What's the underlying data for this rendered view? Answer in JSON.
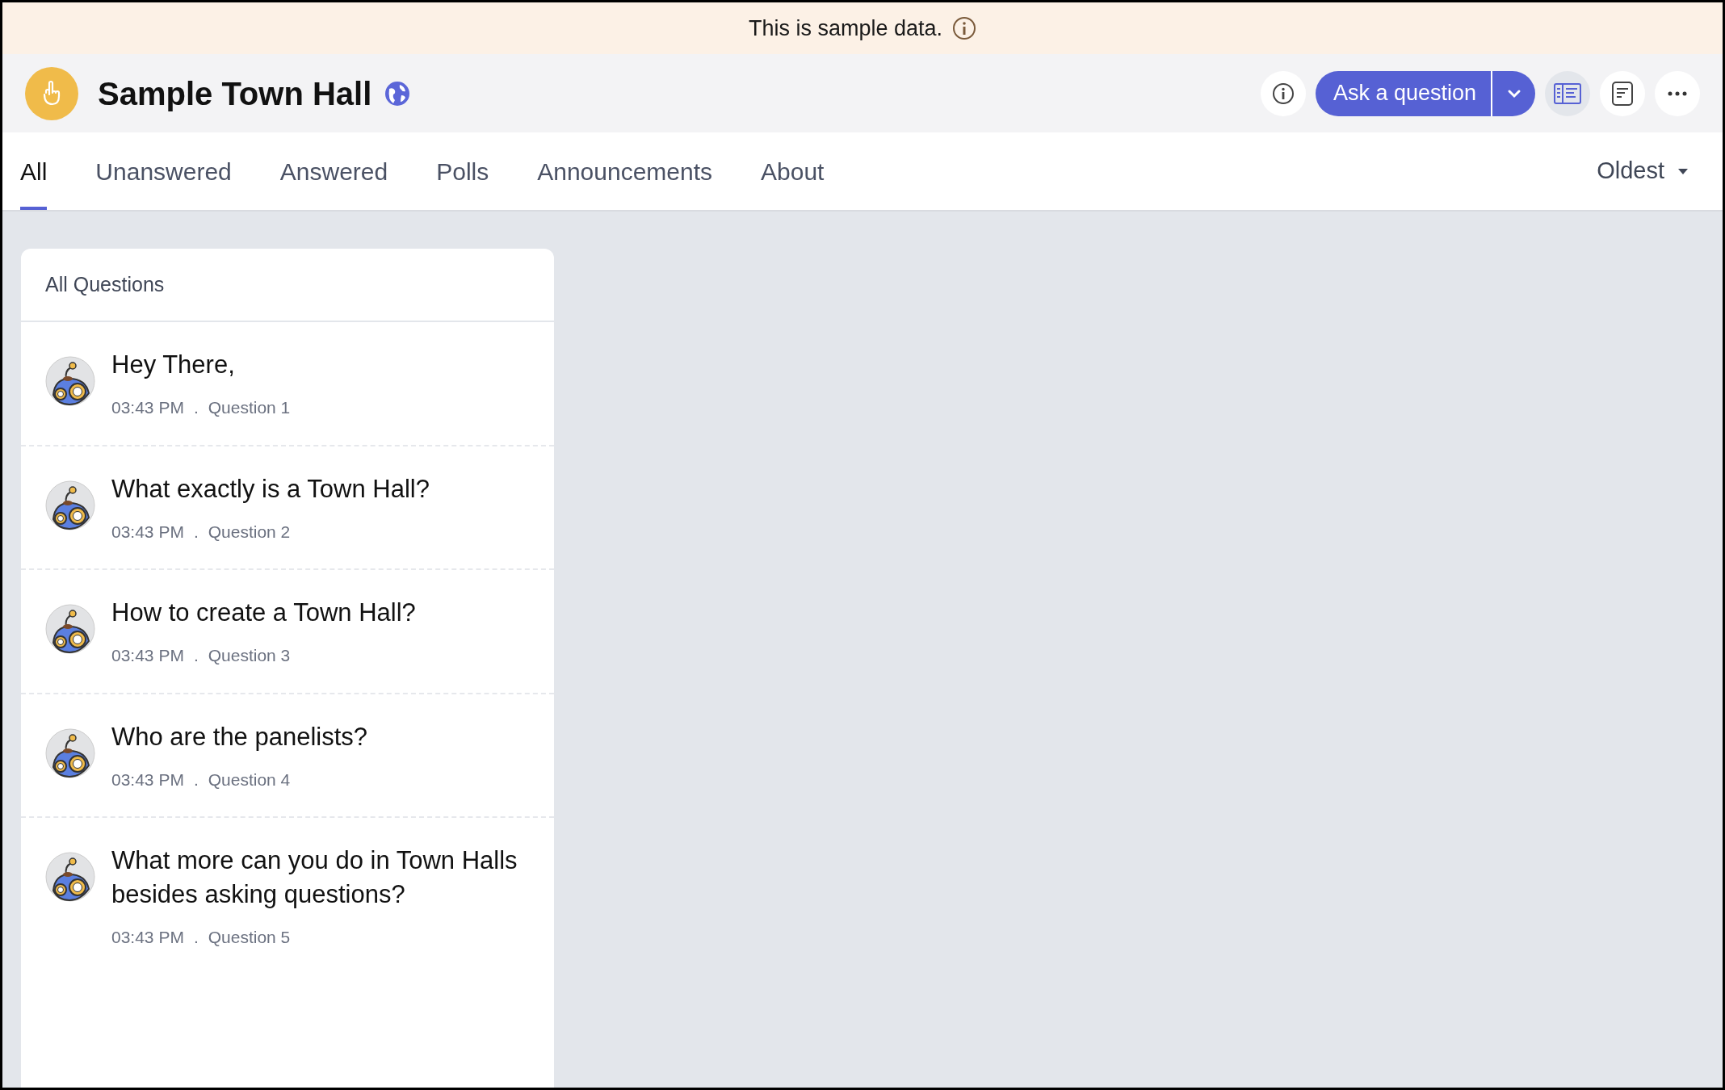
{
  "banner": {
    "text": "This is sample data."
  },
  "header": {
    "title": "Sample Town Hall",
    "ask_button": "Ask a question"
  },
  "tabs": [
    {
      "label": "All",
      "selected": true
    },
    {
      "label": "Unanswered",
      "selected": false
    },
    {
      "label": "Answered",
      "selected": false
    },
    {
      "label": "Polls",
      "selected": false
    },
    {
      "label": "Announcements",
      "selected": false
    },
    {
      "label": "About",
      "selected": false
    }
  ],
  "sort": {
    "label": "Oldest"
  },
  "questions_panel": {
    "title": "All Questions",
    "questions": [
      {
        "text": "Hey There,",
        "time": "03:43 PM",
        "separator": ".",
        "number": "Question 1"
      },
      {
        "text": "What exactly is a Town Hall?",
        "time": "03:43 PM",
        "separator": ".",
        "number": "Question 2"
      },
      {
        "text": "How to create a Town Hall?",
        "time": "03:43 PM",
        "separator": ".",
        "number": "Question 3"
      },
      {
        "text": "Who are the panelists?",
        "time": "03:43 PM",
        "separator": ".",
        "number": "Question 4"
      },
      {
        "text": "What more can you do in Town Halls besides asking questions?",
        "time": "03:43 PM",
        "separator": ".",
        "number": "Question 5"
      }
    ]
  }
}
